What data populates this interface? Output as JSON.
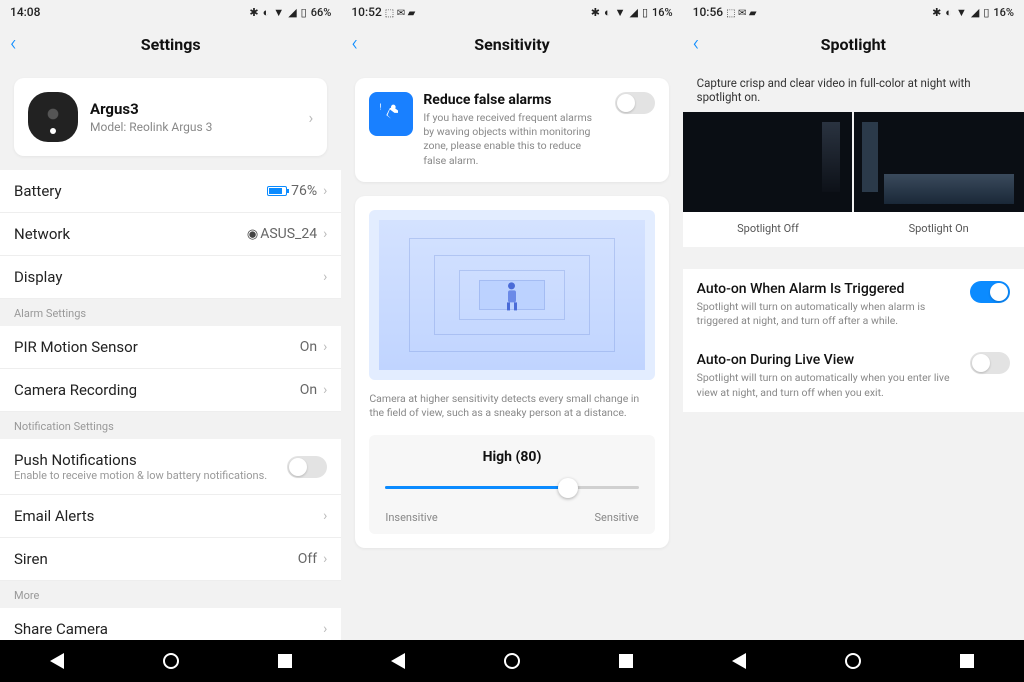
{
  "screen1": {
    "status": {
      "time": "14:08",
      "battery": "66%",
      "icons": "✱ ◐ ▾ ◢ ▯"
    },
    "title": "Settings",
    "device": {
      "name": "Argus3",
      "model": "Model: Reolink Argus 3"
    },
    "rows": {
      "battery": {
        "label": "Battery",
        "value": "76%"
      },
      "network": {
        "label": "Network",
        "value": "ASUS_24"
      },
      "display": {
        "label": "Display"
      }
    },
    "section_alarm": "Alarm Settings",
    "rows2": {
      "pir": {
        "label": "PIR Motion Sensor",
        "value": "On"
      },
      "rec": {
        "label": "Camera Recording",
        "value": "On"
      }
    },
    "section_notif": "Notification Settings",
    "rows3": {
      "push": {
        "label": "Push Notifications",
        "sub": "Enable to receive motion & low battery notifications."
      },
      "email": {
        "label": "Email Alerts"
      },
      "siren": {
        "label": "Siren",
        "value": "Off"
      }
    },
    "section_more": "More",
    "rows4": {
      "share": {
        "label": "Share Camera"
      }
    }
  },
  "screen2": {
    "status": {
      "time": "10:52",
      "battery": "16%",
      "icons": "⬚ ✉ ⬛   ✱ ◐ ▾ ◢ ▯"
    },
    "title": "Sensitivity",
    "reduce": {
      "title": "Reduce false alarms",
      "desc": "If you have received frequent alarms by waving objects within monitoring zone, please enable this to reduce false alarm."
    },
    "illust_caption": "Camera at higher sensitivity detects every small change in the field of view, such as a sneaky person at a distance.",
    "slider": {
      "label": "High (80)",
      "left": "Insensitive",
      "right": "Sensitive"
    }
  },
  "screen3": {
    "status": {
      "time": "10:56",
      "battery": "16%",
      "icons": "⬚ ✉ ⬛   ✱ ◐ ▾ ◢ ▯"
    },
    "title": "Spotlight",
    "intro": "Capture crisp and clear video in full-color at night with spotlight on.",
    "compare": {
      "off": "Spotlight Off",
      "on": "Spotlight On"
    },
    "auto_alarm": {
      "title": "Auto-on When Alarm Is Triggered",
      "desc": "Spotlight will turn on automatically when alarm is triggered at night, and turn off after a while."
    },
    "auto_live": {
      "title": "Auto-on During Live View",
      "desc": "Spotlight will turn on automatically when you enter live view at night, and turn off when you exit."
    }
  }
}
